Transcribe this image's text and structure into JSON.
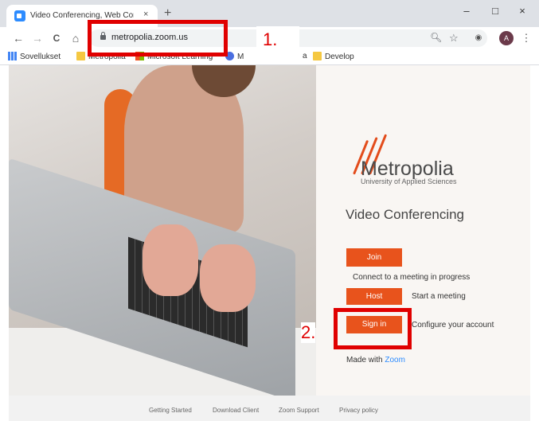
{
  "browser": {
    "tab_title": "Video Conferencing, Web Confe...",
    "tab_close": "×",
    "new_tab": "+",
    "window_controls": {
      "minimize": "–",
      "maximize": "□",
      "close": "×"
    },
    "nav": {
      "back": "←",
      "forward": "→",
      "reload": "C",
      "home": "⌂"
    },
    "url": "metropolia.zoom.us",
    "omnibox_icons": {
      "zoom": "🔍︎",
      "star": "☆"
    },
    "extension": "◉",
    "profile_initial": "A",
    "menu": "⋮",
    "bookmarks": [
      {
        "label": "Sovellukset",
        "icon": "apps"
      },
      {
        "label": "Metropolia",
        "icon": "folder"
      },
      {
        "label": "Microsoft Learning",
        "icon": "ms"
      },
      {
        "label": "M",
        "icon": "m"
      },
      {
        "label": "a",
        "icon": "none"
      },
      {
        "label": "Develop",
        "icon": "folder"
      }
    ]
  },
  "page": {
    "brand_name": "Metropolia",
    "brand_sub": "University of Applied Sciences",
    "title": "Video Conferencing",
    "join_label": "Join",
    "join_desc": "Connect to a meeting in progress",
    "host_label": "Host",
    "host_desc": "Start a meeting",
    "signin_label": "Sign in",
    "signin_desc": "Configure your account",
    "made_with": "Made with",
    "made_with_link": "Zoom",
    "footer": [
      "Getting Started",
      "Download Client",
      "Zoom Support",
      "Privacy policy"
    ],
    "accent_color": "#e8531c"
  },
  "annotations": {
    "label_1": "1.",
    "label_2": "2.",
    "color": "#e00000"
  }
}
